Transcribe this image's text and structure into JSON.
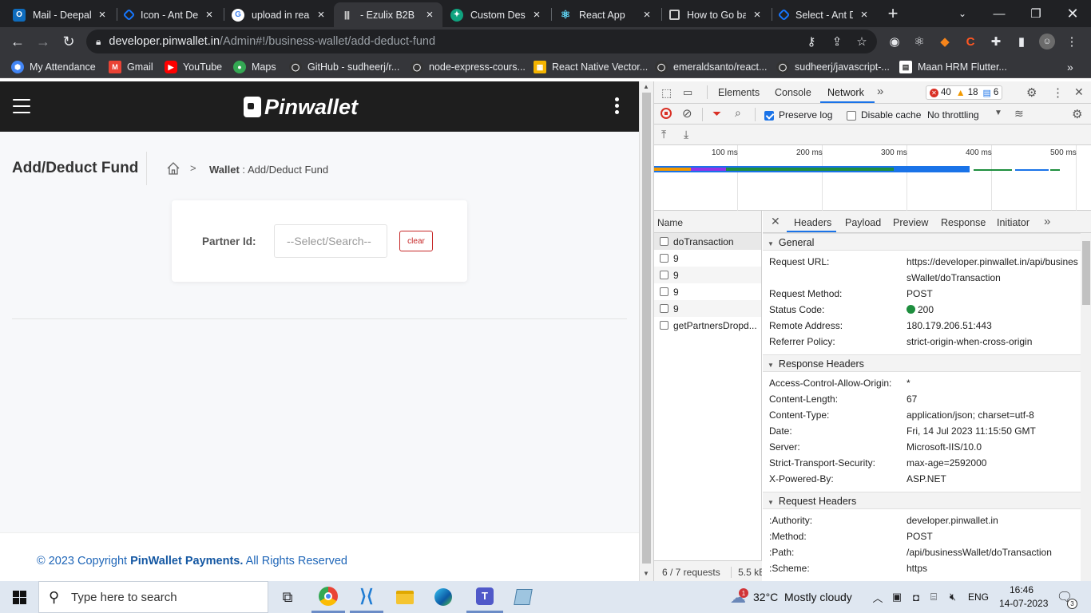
{
  "browser": {
    "tabs": [
      {
        "title": "Mail - Deepal",
        "icon": "outlook-icon",
        "color": "#0f6cbd"
      },
      {
        "title": "Icon - Ant De",
        "icon": "antd-icon",
        "color": "#1677ff"
      },
      {
        "title": "upload in rea",
        "icon": "google-icon",
        "color": "#4285f4"
      },
      {
        "title": "- Ezulix B2B",
        "icon": "ezulix-icon",
        "color": "#888888"
      },
      {
        "title": "Custom Desig",
        "icon": "chatgpt-icon",
        "color": "#10a37f"
      },
      {
        "title": "React App",
        "icon": "react-icon",
        "color": "#61dafb"
      },
      {
        "title": "How to Go ba",
        "icon": "codesandbox-icon",
        "color": "#cccccc"
      },
      {
        "title": "Select - Ant D",
        "icon": "antd-icon",
        "color": "#1677ff"
      }
    ],
    "active_tab": 3,
    "url_host": "developer.pinwallet.in",
    "url_path": "/Admin#!/business-wallet/add-deduct-fund",
    "bookmarks": [
      {
        "label": "My Attendance",
        "icon": "attendance-icon",
        "color": "#4285f4"
      },
      {
        "label": "Gmail",
        "icon": "gmail-icon",
        "color": "#ea4335"
      },
      {
        "label": "YouTube",
        "icon": "youtube-icon",
        "color": "#ff0000"
      },
      {
        "label": "Maps",
        "icon": "maps-icon",
        "color": "#34a853"
      },
      {
        "label": "GitHub - sudheerj/r...",
        "icon": "github-icon",
        "color": "#333333"
      },
      {
        "label": "node-express-cours...",
        "icon": "github-icon",
        "color": "#333333"
      },
      {
        "label": "React Native Vector...",
        "icon": "rn-icon",
        "color": "#f4b400"
      },
      {
        "label": "emeraldsanto/react...",
        "icon": "github-icon",
        "color": "#333333"
      },
      {
        "label": "sudheerj/javascript-...",
        "icon": "github-icon",
        "color": "#333333"
      },
      {
        "label": "Maan HRM Flutter...",
        "icon": "doc-icon",
        "color": "#ffffff"
      }
    ]
  },
  "app": {
    "brand": "Pinwallet",
    "page_title": "Add/Deduct Fund",
    "breadcrumb_section": "Wallet",
    "breadcrumb_page": "Add/Deduct Fund",
    "partner_label": "Partner Id:",
    "partner_placeholder": "--Select/Search--",
    "clear_label": "clear",
    "footer_prefix": "© 2023 Copyright ",
    "footer_company": "PinWallet Payments.",
    "footer_suffix": " All Rights Reserved"
  },
  "devtools": {
    "tabs": [
      "Elements",
      "Console",
      "Network"
    ],
    "active_tab": "Network",
    "errors": "40",
    "warnings": "18",
    "messages": "6",
    "preserve_log": "Preserve log",
    "disable_cache": "Disable cache",
    "throttling": "No throttling",
    "timeline_ticks": [
      "100 ms",
      "200 ms",
      "300 ms",
      "400 ms",
      "500 ms"
    ],
    "name_header": "Name",
    "requests": [
      "doTransaction",
      "9",
      "9",
      "9",
      "9",
      "getPartnersDropd..."
    ],
    "request_count": "6 / 7 requests",
    "transferred": "5.5 kB",
    "detail_tabs": [
      "Headers",
      "Payload",
      "Preview",
      "Response",
      "Initiator"
    ],
    "general_title": "General",
    "general": [
      {
        "k": "Request URL:",
        "v": "https://developer.pinwallet.in/api/businessWallet/doTransaction"
      },
      {
        "k": "Request Method:",
        "v": "POST"
      },
      {
        "k": "Status Code:",
        "v": "200"
      },
      {
        "k": "Remote Address:",
        "v": "180.179.206.51:443"
      },
      {
        "k": "Referrer Policy:",
        "v": "strict-origin-when-cross-origin"
      }
    ],
    "response_title": "Response Headers",
    "response_headers": [
      {
        "k": "Access-Control-Allow-Origin:",
        "v": "*"
      },
      {
        "k": "Content-Length:",
        "v": "67"
      },
      {
        "k": "Content-Type:",
        "v": "application/json; charset=utf-8"
      },
      {
        "k": "Date:",
        "v": "Fri, 14 Jul 2023 11:15:50 GMT"
      },
      {
        "k": "Server:",
        "v": "Microsoft-IIS/10.0"
      },
      {
        "k": "Strict-Transport-Security:",
        "v": "max-age=2592000"
      },
      {
        "k": "X-Powered-By:",
        "v": "ASP.NET"
      }
    ],
    "request_title": "Request Headers",
    "request_headers": [
      {
        "k": ":Authority:",
        "v": "developer.pinwallet.in"
      },
      {
        "k": ":Method:",
        "v": "POST"
      },
      {
        "k": ":Path:",
        "v": "/api/businessWallet/doTransaction"
      },
      {
        "k": ":Scheme:",
        "v": "https"
      }
    ]
  },
  "taskbar": {
    "search_placeholder": "Type here to search",
    "weather_temp": "32°C",
    "weather_desc": "Mostly cloudy",
    "weather_badge": "1",
    "language": "ENG",
    "time": "16:46",
    "date": "14-07-2023",
    "notifications": "3"
  }
}
